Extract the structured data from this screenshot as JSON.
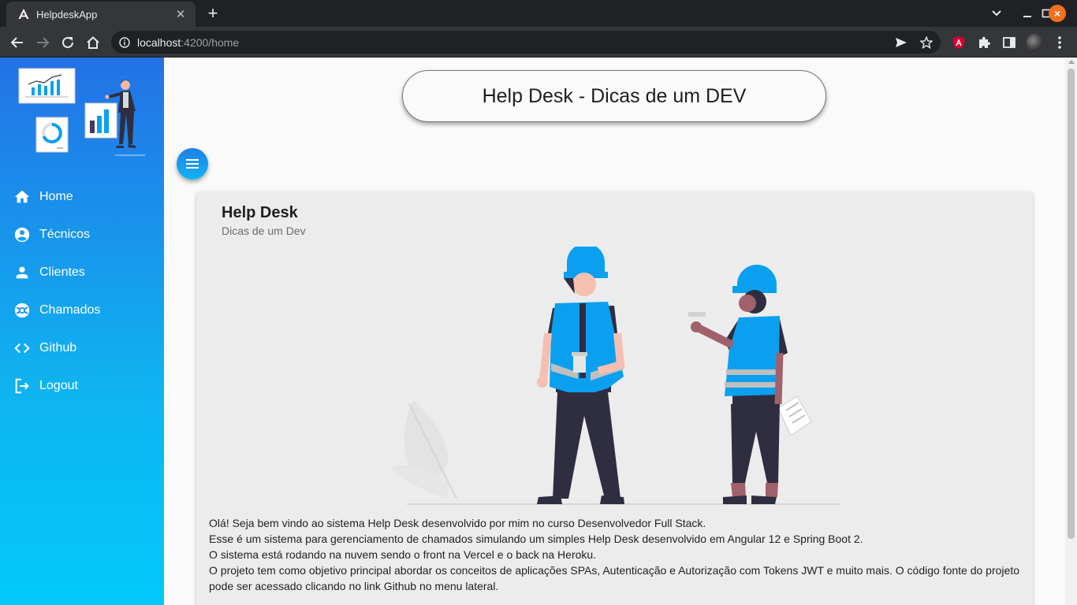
{
  "browser": {
    "tab_title": "HelpdeskApp",
    "tab_close": "✕",
    "new_tab": "+",
    "url_host": "localhost",
    "url_path": ":4200/home",
    "colors": {
      "tabbar": "#202124",
      "toolbar": "#35363a",
      "close_button": "#f2701e"
    }
  },
  "sidebar": {
    "items": [
      {
        "label": "Home",
        "icon": "home-icon"
      },
      {
        "label": "Técnicos",
        "icon": "account-circle-icon"
      },
      {
        "label": "Clientes",
        "icon": "person-icon"
      },
      {
        "label": "Chamados",
        "icon": "support-icon"
      },
      {
        "label": "Github",
        "icon": "code-icon"
      },
      {
        "label": "Logout",
        "icon": "logout-icon"
      }
    ],
    "colors": {
      "gradient_top": "#2372e6",
      "gradient_bottom": "#02c9fb"
    }
  },
  "header": {
    "title": "Help Desk - Dicas de um DEV"
  },
  "card": {
    "title": "Help Desk",
    "subtitle": "Dicas de um Dev",
    "paragraphs": [
      "Olá! Seja bem vindo ao sistema Help Desk desenvolvido por mim no curso Desenvolvedor Full Stack.",
      "Esse é um sistema para gerenciamento de chamados simulando um simples Help Desk desenvolvido em Angular 12 e Spring Boot 2.",
      "O sistema está rodando na nuvem sendo o front na Vercel e o back na Heroku.",
      "O projeto tem como objetivo principal abordar os conceitos de aplicações SPAs, Autenticação e Autorização com Tokens JWT e muito mais. O código fonte do projeto pode ser acessado clicando no link Github no menu lateral."
    ]
  },
  "colors": {
    "accent": "#03a9f4",
    "worker_vest": "#0aa0ef"
  }
}
